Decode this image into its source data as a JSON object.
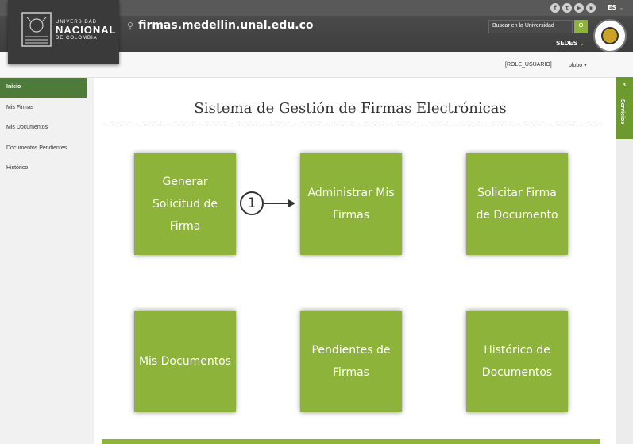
{
  "header": {
    "logo_small_1": "UNIVERSIDAD",
    "logo_big": "NACIONAL",
    "logo_small_2": "DE COLOMBIA",
    "site_url": "firmas.medellin.unal.edu.co",
    "language": "ES",
    "search_placeholder": "Buscar en la Universidad",
    "sedes_label": "SEDES",
    "social_icons": [
      "facebook-icon",
      "twitter-icon",
      "youtube-icon",
      "rss-icon"
    ]
  },
  "subheader": {
    "role": "[ROLE_USUARIO]",
    "user": "plobo"
  },
  "sidebar": {
    "items": [
      {
        "label": "Inicio",
        "active": true
      },
      {
        "label": "Mis Firmas",
        "active": false
      },
      {
        "label": "Mis Documentos",
        "active": false
      },
      {
        "label": "Documentos Pendientes",
        "active": false
      },
      {
        "label": "Histórico",
        "active": false
      }
    ]
  },
  "services_tab": {
    "label": "Servicios"
  },
  "main": {
    "title": "Sistema de Gestión de Firmas Electrónicas",
    "tiles": [
      {
        "label": "Generar Solicitud de Firma"
      },
      {
        "label": "Administrar Mis Firmas"
      },
      {
        "label": "Solicitar Firma de Documento"
      },
      {
        "label": "Mis Documentos"
      },
      {
        "label": "Pendientes de Firmas"
      },
      {
        "label": "Histórico de Documentos"
      }
    ],
    "callout_number": "1"
  },
  "colors": {
    "accent_green": "#8db33a",
    "sidebar_active": "#4e7b3a",
    "header_dark": "#3e3e3e"
  }
}
